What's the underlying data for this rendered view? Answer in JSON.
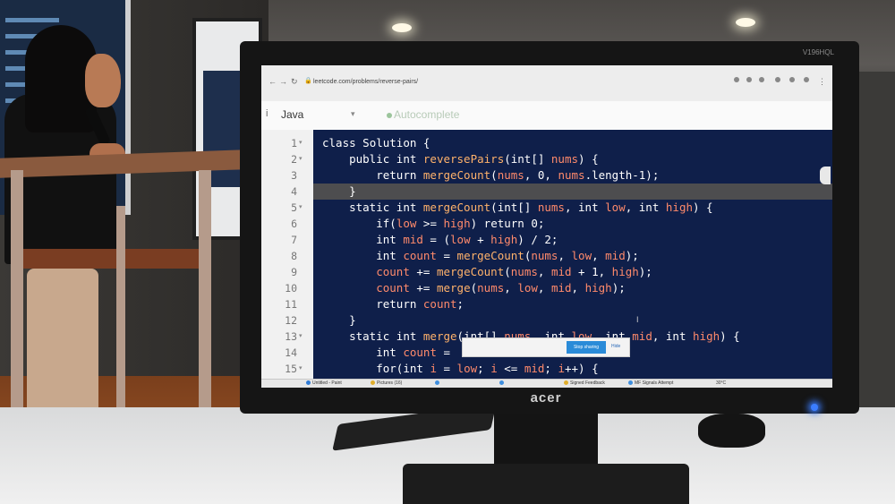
{
  "browser": {
    "url": "leetcode.com/problems/reverse-pairs/"
  },
  "editor": {
    "language": "Java",
    "autocomplete_label": "Autocomplete",
    "code_lines": [
      {
        "n": "1",
        "fold": "▾",
        "text": "class Solution {"
      },
      {
        "n": "2",
        "fold": "▾",
        "text": "    public int reversePairs(int[] nums) {"
      },
      {
        "n": "3",
        "fold": "",
        "text": "        return mergeCount(nums, 0, nums.length-1);"
      },
      {
        "n": "4",
        "fold": "",
        "text": "    }"
      },
      {
        "n": "5",
        "fold": "▾",
        "text": "    static int mergeCount(int[] nums, int low, int high) {"
      },
      {
        "n": "6",
        "fold": "",
        "text": "        if(low >= high) return 0;"
      },
      {
        "n": "7",
        "fold": "",
        "text": "        int mid = (low + high) / 2;"
      },
      {
        "n": "8",
        "fold": "",
        "text": "        int count = mergeCount(nums, low, mid);"
      },
      {
        "n": "9",
        "fold": "",
        "text": "        count += mergeCount(nums, mid + 1, high);"
      },
      {
        "n": "10",
        "fold": "",
        "text": "        count += merge(nums, low, mid, high);"
      },
      {
        "n": "11",
        "fold": "",
        "text": "        return count;"
      },
      {
        "n": "12",
        "fold": "",
        "text": "    }"
      },
      {
        "n": "13",
        "fold": "▾",
        "text": "    static int merge(int[] nums, int low, int mid, int high) {"
      },
      {
        "n": "14",
        "fold": "",
        "text": "        int count = "
      },
      {
        "n": "15",
        "fold": "▾",
        "text": "        for(int i = low; i <= mid; i++) {"
      }
    ]
  },
  "popup": {
    "stop_label": "Stop sharing",
    "hide_label": "Hide"
  },
  "taskbar": {
    "items": [
      {
        "label": "Untitled - Paint",
        "color": "#2f7bd6"
      },
      {
        "label": "Pictures (16)",
        "color": "#e0ad2b"
      },
      {
        "label": "",
        "color": "#3e8ede"
      },
      {
        "label": "",
        "color": "#3e8ede"
      },
      {
        "label": "Signed Feedback",
        "color": "#e0ad2b"
      },
      {
        "label": "MF Signals Attempt",
        "color": "#3e8ede"
      }
    ],
    "temperature": "30°C"
  },
  "monitor": {
    "brand": "acer",
    "model": "V196HQL"
  }
}
